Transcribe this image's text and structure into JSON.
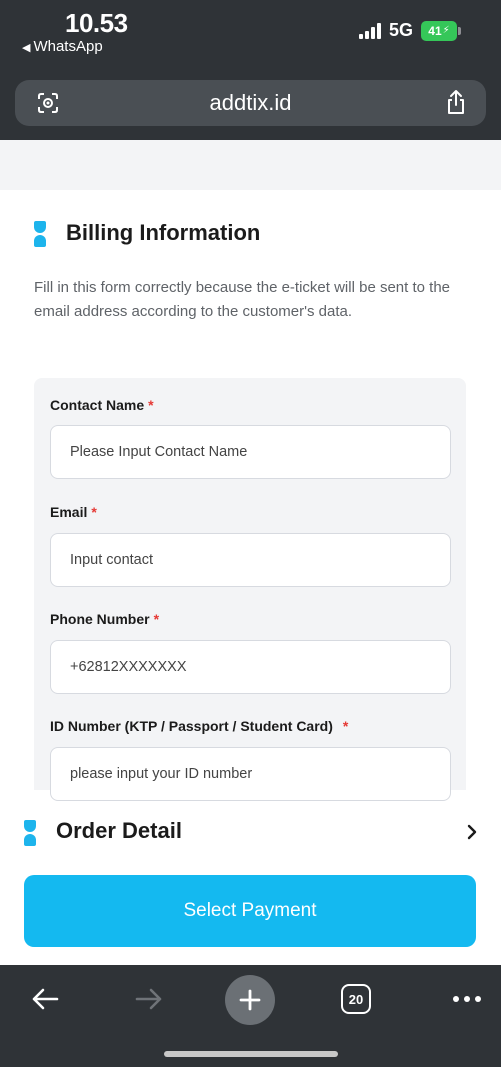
{
  "status_bar": {
    "time": "10.53",
    "back_app": "WhatsApp",
    "network": "5G",
    "battery": "41"
  },
  "browser": {
    "url": "addtix.id",
    "tab_count": "20"
  },
  "billing": {
    "title": "Billing Information",
    "description": "Fill in this form correctly because the e-ticket will be sent to the email address according to the customer's data.",
    "fields": [
      {
        "label": "Contact Name",
        "required": "*",
        "placeholder": "Please Input Contact Name"
      },
      {
        "label": "Email",
        "required": "*",
        "placeholder": "Input contact"
      },
      {
        "label": "Phone Number",
        "required": "*",
        "placeholder": "+62812XXXXXXX"
      },
      {
        "label": "ID Number (KTP / Passport / Student Card)",
        "required": "*",
        "placeholder": "please input your ID number"
      }
    ]
  },
  "order_detail": {
    "title": "Order Detail"
  },
  "actions": {
    "select_payment": "Select Payment"
  },
  "colors": {
    "accent": "#14b9f0",
    "required": "#e53935",
    "chrome_bg": "#2f3337",
    "battery": "#35c759"
  }
}
